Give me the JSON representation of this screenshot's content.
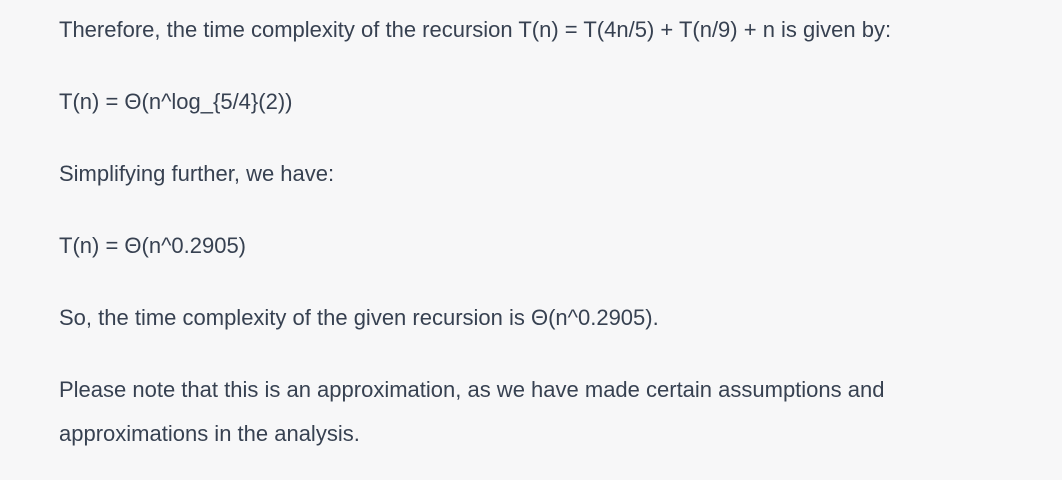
{
  "message": {
    "paragraphs": [
      "Therefore, the time complexity of the recursion T(n) = T(4n/5) + T(n/9) + n is given by:",
      "T(n) = Θ(n^log_{5/4}(2))",
      "Simplifying further, we have:",
      "T(n) = Θ(n^0.2905)",
      "So, the time complexity of the given recursion is Θ(n^0.2905).",
      "Please note that this is an approximation, as we have made certain assumptions and approximations in the analysis."
    ]
  },
  "colors": {
    "background": "#f7f7f8",
    "text": "#374151"
  }
}
